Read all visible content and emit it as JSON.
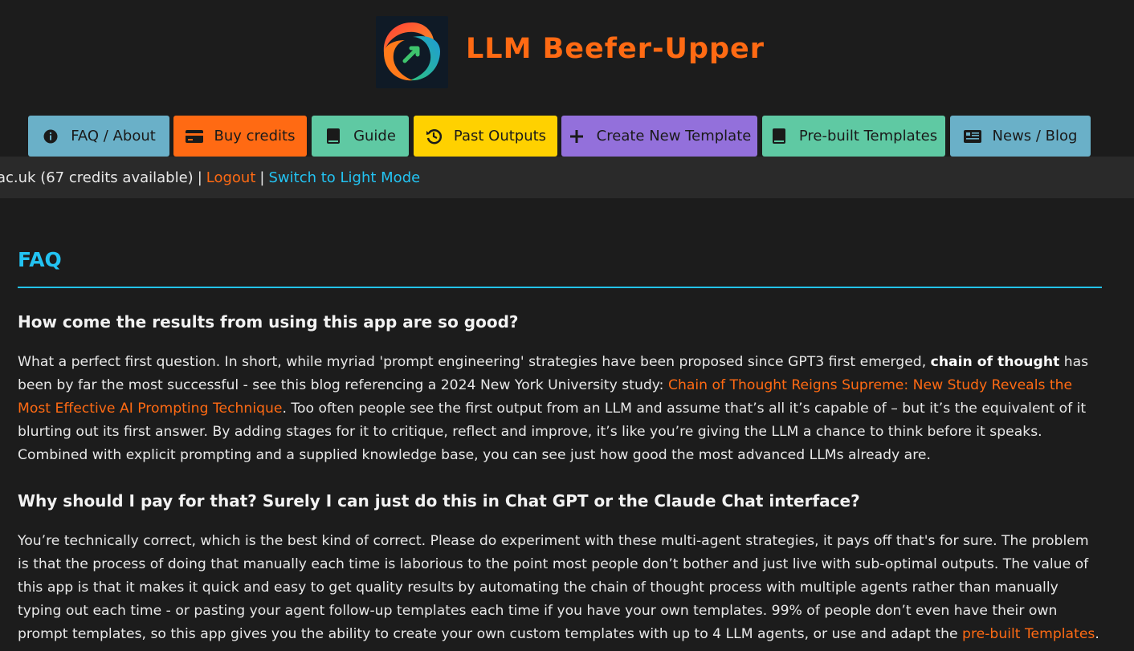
{
  "header": {
    "brand_title": "LLM Beefer-Upper"
  },
  "nav": [
    {
      "label": "FAQ / About",
      "icon": "info-icon",
      "bg": "#6ab0c8"
    },
    {
      "label": "Buy credits",
      "icon": "credit-card-icon",
      "bg": "#ff6a13"
    },
    {
      "label": "Guide",
      "icon": "book-icon",
      "bg": "#5fc9a3"
    },
    {
      "label": "Past Outputs",
      "icon": "history-icon",
      "bg": "#ffd100"
    },
    {
      "label": "Create New Template",
      "icon": "plus-icon",
      "bg": "#9370db"
    },
    {
      "label": "Pre-built Templates",
      "icon": "book-icon",
      "bg": "#5fc9a3"
    },
    {
      "label": "News / Blog",
      "icon": "newspaper-icon",
      "bg": "#6ab0c8"
    }
  ],
  "statusbar": {
    "account_text": "ac.uk (67 credits available)",
    "separator": "|",
    "logout_label": "Logout",
    "theme_toggle_label": "Switch to Light Mode"
  },
  "faq": {
    "heading": "FAQ",
    "q1": "How come the results from using this app are so good?",
    "a1_part1": "What a perfect first question. In short, while myriad 'prompt engineering' strategies have been proposed since GPT3 first emerged, ",
    "a1_bold": "chain of thought",
    "a1_part2": " has been by far the most successful - see this blog referencing a 2024 New York University study: ",
    "a1_link": "Chain of Thought Reigns Supreme: New Study Reveals the Most Effective AI Prompting Technique",
    "a1_part3": ". Too often people see the first output from an LLM and assume that’s all it’s capable of – but it’s the equivalent of it blurting out its first answer. By adding stages for it to critique, reflect and improve, it’s like you’re giving the LLM a chance to think before it speaks. Combined with explicit prompting and a supplied knowledge base, you can see just how good the most advanced LLMs already are.",
    "q2": "Why should I pay for that? Surely I can just do this in Chat GPT or the Claude Chat interface?",
    "a2_part1": "You’re technically correct, which is the best kind of correct. Please do experiment with these multi-agent strategies, it pays off that's for sure. The problem is that the process of doing that manually each time is laborious to the point most people don’t bother and just live with sub-optimal outputs. The value of this app is that it makes it quick and easy to get quality results by automating the chain of thought process with multiple agents rather than manually typing out each time - or pasting your agent follow-up templates each time if you have your own templates. 99% of people don’t even have their own prompt templates, so this app gives you the ability to create your own custom templates with up to 4 LLM agents, or use and adapt the ",
    "a2_link": "pre-built Templates",
    "a2_part2": "."
  }
}
